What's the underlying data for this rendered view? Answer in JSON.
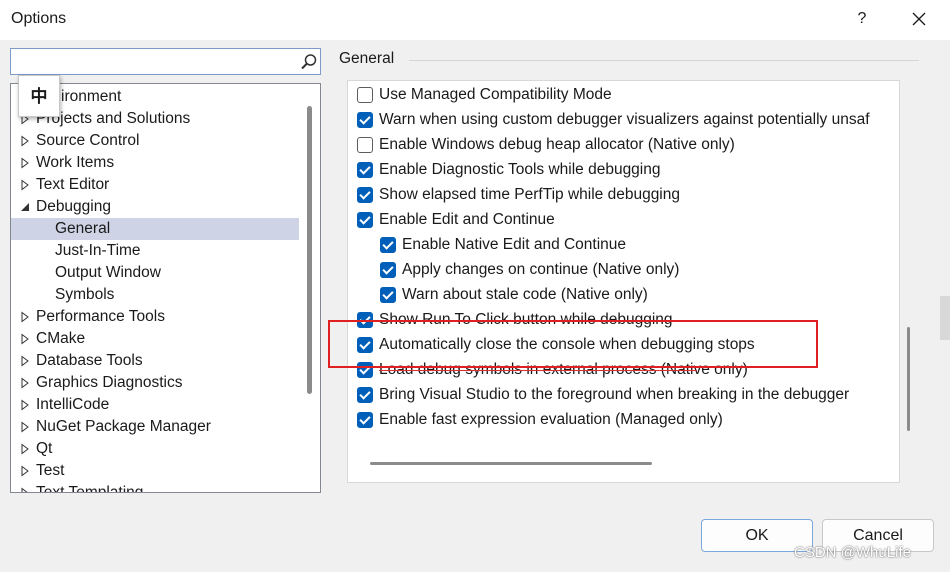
{
  "window": {
    "title": "Options",
    "help_label": "?"
  },
  "search": {
    "value": "",
    "placeholder": ""
  },
  "ime_popup": {
    "label": "中"
  },
  "tree": {
    "items": [
      {
        "label": "Environment",
        "display": "ironment",
        "expander": "none",
        "indent": 1,
        "selected": false
      },
      {
        "label": "Projects and Solutions",
        "expander": "collapsed",
        "indent": 1,
        "selected": false
      },
      {
        "label": "Source Control",
        "expander": "collapsed",
        "indent": 1,
        "selected": false
      },
      {
        "label": "Work Items",
        "expander": "collapsed",
        "indent": 1,
        "selected": false
      },
      {
        "label": "Text Editor",
        "expander": "collapsed",
        "indent": 1,
        "selected": false
      },
      {
        "label": "Debugging",
        "expander": "expanded",
        "indent": 1,
        "selected": false
      },
      {
        "label": "General",
        "expander": "none",
        "indent": 2,
        "selected": true
      },
      {
        "label": "Just-In-Time",
        "expander": "none",
        "indent": 2,
        "selected": false
      },
      {
        "label": "Output Window",
        "expander": "none",
        "indent": 2,
        "selected": false
      },
      {
        "label": "Symbols",
        "expander": "none",
        "indent": 2,
        "selected": false
      },
      {
        "label": "Performance Tools",
        "expander": "collapsed",
        "indent": 1,
        "selected": false
      },
      {
        "label": "CMake",
        "expander": "collapsed",
        "indent": 1,
        "selected": false
      },
      {
        "label": "Database Tools",
        "expander": "collapsed",
        "indent": 1,
        "selected": false
      },
      {
        "label": "Graphics Diagnostics",
        "expander": "collapsed",
        "indent": 1,
        "selected": false
      },
      {
        "label": "IntelliCode",
        "expander": "collapsed",
        "indent": 1,
        "selected": false
      },
      {
        "label": "NuGet Package Manager",
        "expander": "collapsed",
        "indent": 1,
        "selected": false
      },
      {
        "label": "Qt",
        "expander": "collapsed",
        "indent": 1,
        "selected": false
      },
      {
        "label": "Test",
        "expander": "collapsed",
        "indent": 1,
        "selected": false
      },
      {
        "label": "Text Templating",
        "expander": "collapsed",
        "indent": 1,
        "selected": false
      }
    ]
  },
  "group": {
    "title": "General"
  },
  "options": [
    {
      "label": "Use Managed Compatibility Mode",
      "checked": false,
      "level": 1,
      "struck": false
    },
    {
      "label": "Warn when using custom debugger visualizers against potentially unsaf",
      "checked": true,
      "level": 1,
      "struck": false
    },
    {
      "label": "Enable Windows debug heap allocator (Native only)",
      "checked": false,
      "level": 1,
      "struck": false
    },
    {
      "label": "Enable Diagnostic Tools while debugging",
      "checked": true,
      "level": 1,
      "struck": false
    },
    {
      "label": "Show elapsed time PerfTip while debugging",
      "checked": true,
      "level": 1,
      "struck": false
    },
    {
      "label": "Enable Edit and Continue",
      "checked": true,
      "level": 1,
      "struck": false
    },
    {
      "label": "Enable Native Edit and Continue",
      "checked": true,
      "level": 2,
      "struck": false
    },
    {
      "label": "Apply changes on continue (Native only)",
      "checked": true,
      "level": 2,
      "struck": false
    },
    {
      "label": "Warn about stale code (Native only)",
      "checked": true,
      "level": 2,
      "struck": false
    },
    {
      "label": "Show Run To Click button while debugging",
      "checked": true,
      "level": 1,
      "struck": true
    },
    {
      "label": "Automatically close the console when debugging stops",
      "checked": true,
      "level": 1,
      "struck": false
    },
    {
      "label": "Load debug symbols in external process (Native only)",
      "checked": true,
      "level": 1,
      "struck": true
    },
    {
      "label": "Bring Visual Studio to the foreground when breaking in the debugger",
      "checked": true,
      "level": 1,
      "struck": false
    },
    {
      "label": "Enable fast expression evaluation (Managed only)",
      "checked": true,
      "level": 1,
      "struck": false
    }
  ],
  "buttons": {
    "ok": "OK",
    "cancel": "Cancel"
  },
  "watermark": "CSDN @WhuLife",
  "colors": {
    "accent": "#005fb8",
    "selection": "#cfd3e6",
    "annotation": "#e02020"
  }
}
